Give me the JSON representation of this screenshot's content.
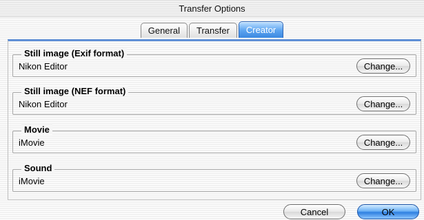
{
  "window": {
    "title": "Transfer Options"
  },
  "tabs": [
    {
      "label": "General",
      "active": false
    },
    {
      "label": "Transfer",
      "active": false
    },
    {
      "label": "Creator",
      "active": true
    }
  ],
  "groups": [
    {
      "title": "Still image (Exif format)",
      "value": "Nikon Editor",
      "button": "Change..."
    },
    {
      "title": "Still image (NEF format)",
      "value": "Nikon Editor",
      "button": "Change..."
    },
    {
      "title": "Movie",
      "value": "iMovie",
      "button": "Change..."
    },
    {
      "title": "Sound",
      "value": "iMovie",
      "button": "Change..."
    }
  ],
  "footer": {
    "cancel_label": "Cancel",
    "ok_label": "OK"
  },
  "colors": {
    "accent": "#4a8de0",
    "panel_border": "#5f8fd6"
  }
}
